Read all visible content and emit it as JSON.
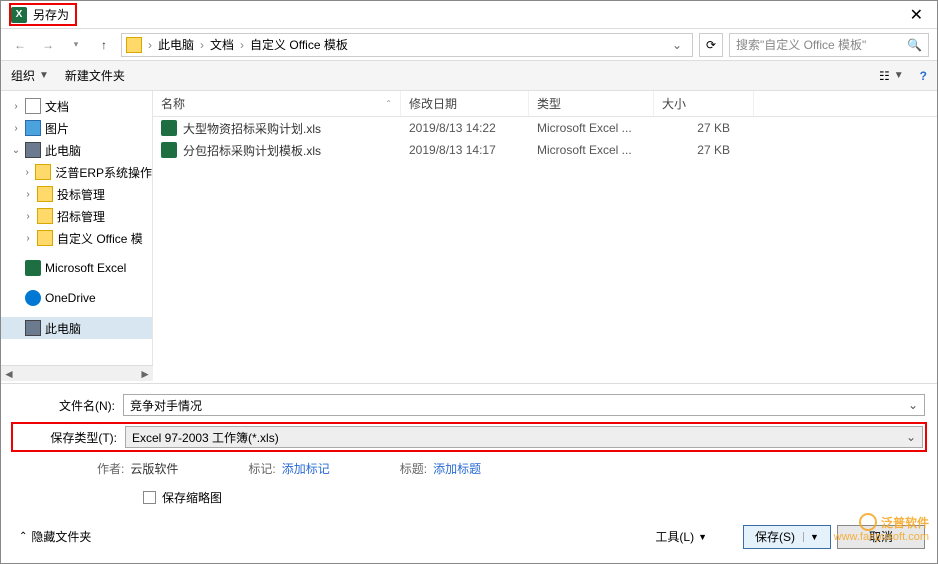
{
  "title": "另存为",
  "breadcrumb": {
    "items": [
      "此电脑",
      "文档",
      "自定义 Office 模板"
    ]
  },
  "search_placeholder": "搜索\"自定义 Office 模板\"",
  "toolbar": {
    "organize": "组织",
    "new_folder": "新建文件夹"
  },
  "sidebar": {
    "items": [
      {
        "label": "文档",
        "icon": "docs",
        "chev": ">"
      },
      {
        "label": "图片",
        "icon": "pics",
        "chev": ">"
      },
      {
        "label": "此电脑",
        "icon": "pc",
        "chev": "v"
      },
      {
        "label": "泛普ERP系统操作",
        "icon": "folder",
        "chev": ">",
        "indent": true
      },
      {
        "label": "投标管理",
        "icon": "folder",
        "chev": ">",
        "indent": true
      },
      {
        "label": "招标管理",
        "icon": "folder",
        "chev": ">",
        "indent": true
      },
      {
        "label": "自定义 Office 模",
        "icon": "folder",
        "chev": ">",
        "indent": true
      }
    ],
    "items2": [
      {
        "label": "Microsoft Excel",
        "icon": "excel"
      },
      {
        "label": "OneDrive",
        "icon": "onedrive"
      },
      {
        "label": "此电脑",
        "icon": "pc",
        "sel": true
      }
    ]
  },
  "columns": {
    "name": "名称",
    "date": "修改日期",
    "type": "类型",
    "size": "大小"
  },
  "files": [
    {
      "name": "大型物资招标采购计划.xls",
      "date": "2019/8/13 14:22",
      "type": "Microsoft Excel ...",
      "size": "27 KB"
    },
    {
      "name": "分包招标采购计划模板.xls",
      "date": "2019/8/13 14:17",
      "type": "Microsoft Excel ...",
      "size": "27 KB"
    }
  ],
  "filename_label": "文件名(N):",
  "filename_value": "竞争对手情况",
  "filetype_label": "保存类型(T):",
  "filetype_value": "Excel 97-2003 工作簿(*.xls)",
  "meta": {
    "author_label": "作者:",
    "author_value": "云版软件",
    "tags_label": "标记:",
    "tags_value": "添加标记",
    "title_label": "标题:",
    "title_value": "添加标题"
  },
  "save_thumbnail": "保存缩略图",
  "hide_folders": "隐藏文件夹",
  "tools": "工具(L)",
  "save": "保存(S)",
  "cancel": "取消",
  "watermark": {
    "brand": "泛普软件",
    "url": "www.fanpusoft.com"
  }
}
